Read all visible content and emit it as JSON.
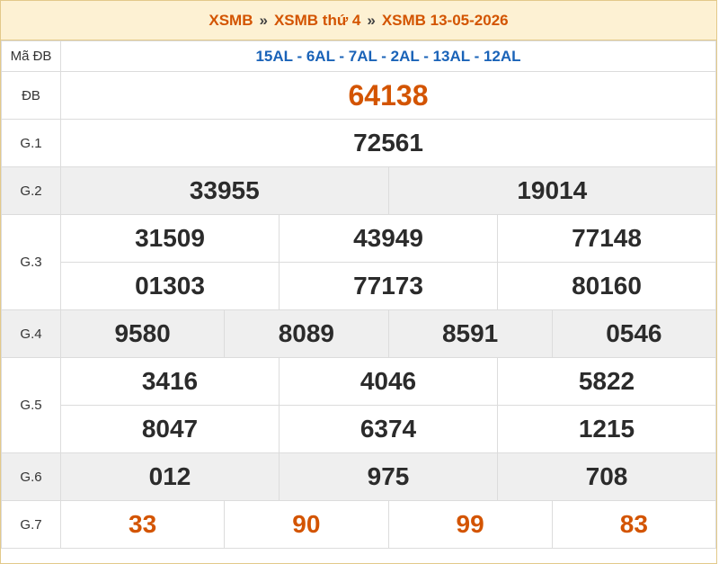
{
  "header": {
    "crumb1": "XSMB",
    "crumb2": "XSMB thứ 4",
    "crumb3": "XSMB 13-05-2026",
    "separator": "»"
  },
  "rows": {
    "code": {
      "label": "Mã ĐB",
      "value": "15AL - 6AL - 7AL - 2AL - 13AL - 12AL"
    },
    "db": {
      "label": "ĐB",
      "values": [
        "64138"
      ]
    },
    "g1": {
      "label": "G.1",
      "values": [
        "72561"
      ]
    },
    "g2": {
      "label": "G.2",
      "values": [
        "33955",
        "19014"
      ]
    },
    "g3": {
      "label": "G.3",
      "values": [
        "31509",
        "43949",
        "77148",
        "01303",
        "77173",
        "80160"
      ]
    },
    "g4": {
      "label": "G.4",
      "values": [
        "9580",
        "8089",
        "8591",
        "0546"
      ]
    },
    "g5": {
      "label": "G.5",
      "values": [
        "3416",
        "4046",
        "5822",
        "8047",
        "6374",
        "1215"
      ]
    },
    "g6": {
      "label": "G.6",
      "values": [
        "012",
        "975",
        "708"
      ]
    },
    "g7": {
      "label": "G.7",
      "values": [
        "33",
        "90",
        "99",
        "83"
      ]
    }
  },
  "colors": {
    "accent": "#d35400",
    "code_blue": "#1a63b8",
    "header_bg": "#fdf1d3",
    "shade": "#efefef"
  }
}
